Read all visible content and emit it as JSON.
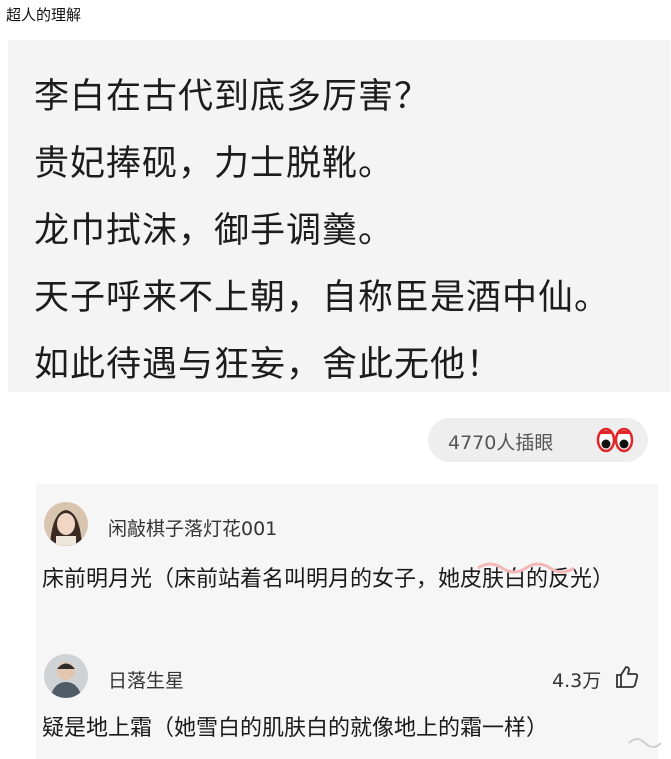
{
  "header": {
    "title": "超人的理解"
  },
  "post": {
    "lines": [
      "李白在古代到底多厉害？",
      "贵妃捧砚，力士脱靴。",
      "龙巾拭沫，御手调羹。",
      "天子呼来不上朝，自称臣是酒中仙。",
      "如此待遇与狂妄，舍此无他！"
    ]
  },
  "peek": {
    "label": "4770人插眼",
    "icon": "eyes-icon"
  },
  "comments": [
    {
      "username": "闲敲棋子落灯花001",
      "text": "床前明月光（床前站着名叫明月的女子，她皮肤白的反光）"
    },
    {
      "username": "日落生星",
      "likes": "4.3万",
      "like_icon": "thumbs-up-icon",
      "text": "疑是地上霜（她雪白的肌肤白的就像地上的霜一样）"
    }
  ],
  "colors": {
    "post_background": "#f4f4f4",
    "peek_background": "#eeeeee",
    "comment_background": "#f6f6f6",
    "eyes_red": "#e0262b"
  }
}
